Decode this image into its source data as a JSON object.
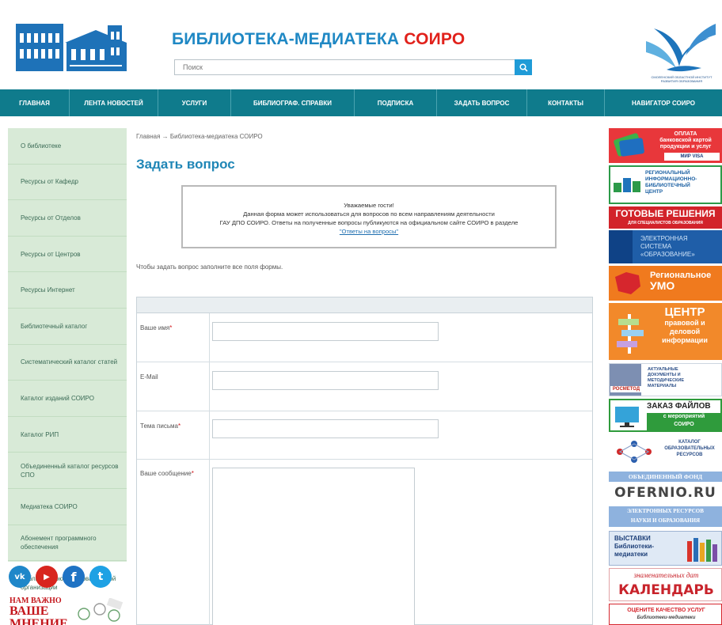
{
  "header": {
    "title_main": "БИБЛИОТЕКА-МЕДИАТЕКА ",
    "title_accent": "СОИРО",
    "search_placeholder": "Поиск",
    "bird_logo_caption": "СМОЛЕНСКИЙ ОБЛАСТНОЙ ИНСТИТУТ РАЗВИТИЯ ОБРАЗОВАНИЯ"
  },
  "nav": {
    "items": [
      {
        "label": "ГЛАВНАЯ"
      },
      {
        "label": "ЛЕНТА НОВОСТЕЙ"
      },
      {
        "label": "УСЛУГИ"
      },
      {
        "label": "БИБЛИОГРАФ. СПРАВКИ"
      },
      {
        "label": "ПОДПИСКА"
      },
      {
        "label": "ЗАДАТЬ ВОПРОС"
      },
      {
        "label": "КОНТАКТЫ"
      },
      {
        "label": "НАВИГАТОР СОИРО"
      }
    ]
  },
  "sidebar": {
    "items": [
      {
        "label": "О библиотеке"
      },
      {
        "label": "Ресурсы от Кафедр"
      },
      {
        "label": "Ресурсы от Отделов"
      },
      {
        "label": "Ресурсы от Центров"
      },
      {
        "label": "Ресурсы Интернет"
      },
      {
        "label": "Библиотечный каталог"
      },
      {
        "label": "Систематический каталог статей"
      },
      {
        "label": "Каталог изданий СОИРО"
      },
      {
        "label": "Каталог РИП"
      },
      {
        "label": "Объединенный каталог ресурсов СПО"
      },
      {
        "label": "Медиатека СОИРО"
      },
      {
        "label": "Абонемент программного обеспечения"
      },
      {
        "label": "Библиотекарю образовательной организации"
      }
    ],
    "social": [
      {
        "name": "vk",
        "glyph": "vk",
        "color": "#1f87c9"
      },
      {
        "name": "youtube",
        "glyph": "▶",
        "color": "#d8261e"
      },
      {
        "name": "facebook",
        "glyph": "f",
        "color": "#1f73c4"
      },
      {
        "name": "twitter",
        "glyph": "t",
        "color": "#1ea1e4"
      }
    ],
    "feedback_line1": "НАМ ВАЖНО",
    "feedback_line2": "ВАШЕ",
    "feedback_line3": "МНЕНИЕ"
  },
  "main": {
    "breadcrumb": "Главная → Библиотека-медиатека СОИРО",
    "page_title": "Задать вопрос",
    "notice": {
      "greeting": "Уважаемые гости!",
      "line1": "Данная форма может использоваться для вопросов по всем направлениям деятельности",
      "line2": "ГАУ ДПО СОИРО. Ответы на полученные вопросы публикуются на официальном сайте СОИРО в разделе",
      "link": "\"Ответы на вопросы\""
    },
    "form_hint": "Чтобы задать вопрос заполните все поля формы.",
    "form": {
      "name_label": "Ваше имя",
      "email_label": "E-Mail",
      "subject_label": "Тема письма",
      "message_label": "Ваше сообщение",
      "required_mark": "*"
    }
  },
  "right_banners": {
    "payment_line1": "ОПЛАТА",
    "payment_line2": "банковской картой",
    "payment_line3": "продукции и услуг",
    "payment_cards": "МИР VISA",
    "ric_line1": "РЕГИОНАЛЬНЫЙ",
    "ric_line2": "ИНФОРМАЦИОННО-",
    "ric_line3": "БИБЛИОТЕЧНЫЙ",
    "ric_line4": "ЦЕНТР",
    "ready_line1": "ГОТОВЫЕ РЕШЕНИЯ",
    "ready_line2": "ДЛЯ СПЕЦИАЛИСТОВ ОБРАЗОВАНИЯ",
    "esys_line1": "ЭЛЕКТРОННАЯ",
    "esys_line2": "СИСТЕМА",
    "esys_line3": "«ОБРАЗОВАНИЕ»",
    "umo_line1": "Региональное",
    "umo_line2": "УМО",
    "center_line1": "ЦЕНТР",
    "center_line2": "правовой и",
    "center_line3": "деловой",
    "center_line4": "информации",
    "rosmetod_name": "РОСМЕТОД",
    "rosmetod_line1": "АКТУАЛЬНЫЕ",
    "rosmetod_line2": "ДОКУМЕНТЫ И",
    "rosmetod_line3": "МЕТОДИЧЕСКИЕ",
    "rosmetod_line4": "МАТЕРИАЛЫ",
    "files_line1": "ЗАКАЗ ФАЙЛОВ",
    "files_line2": "с мероприятий",
    "files_line3": "СОИРО",
    "catalog_line1": "КАТАЛОГ",
    "catalog_line2": "ОБРАЗОВАТЕЛЬНЫХ",
    "catalog_line3": "РЕСУРСОВ",
    "fund_line": "ОБЪЕДИНЕННЫЙ ФОНД",
    "ofernio": "OFERNIO.RU",
    "eres_line1": "ЭЛЕКТРОННЫХ РЕСУРСОВ",
    "eres_line2": "НАУКИ И ОБРАЗОВАНИЯ",
    "expo_line1": "ВЫСТАВКИ",
    "expo_line2": "Библиотеки-",
    "expo_line3": "медиатеки",
    "cal_line1": "знаменательных дат",
    "cal_line2": "КАЛЕНДАРЬ",
    "rate_line1": "ОЦЕНИТЕ КАЧЕСТВО УСЛУГ",
    "rate_line2": "Библиотеки-медиатеки"
  },
  "colors": {
    "brand_blue": "#1f88c4",
    "brand_red": "#e1211b",
    "nav_teal": "#0f7b8c",
    "sidebar_green": "#d8ead7"
  }
}
